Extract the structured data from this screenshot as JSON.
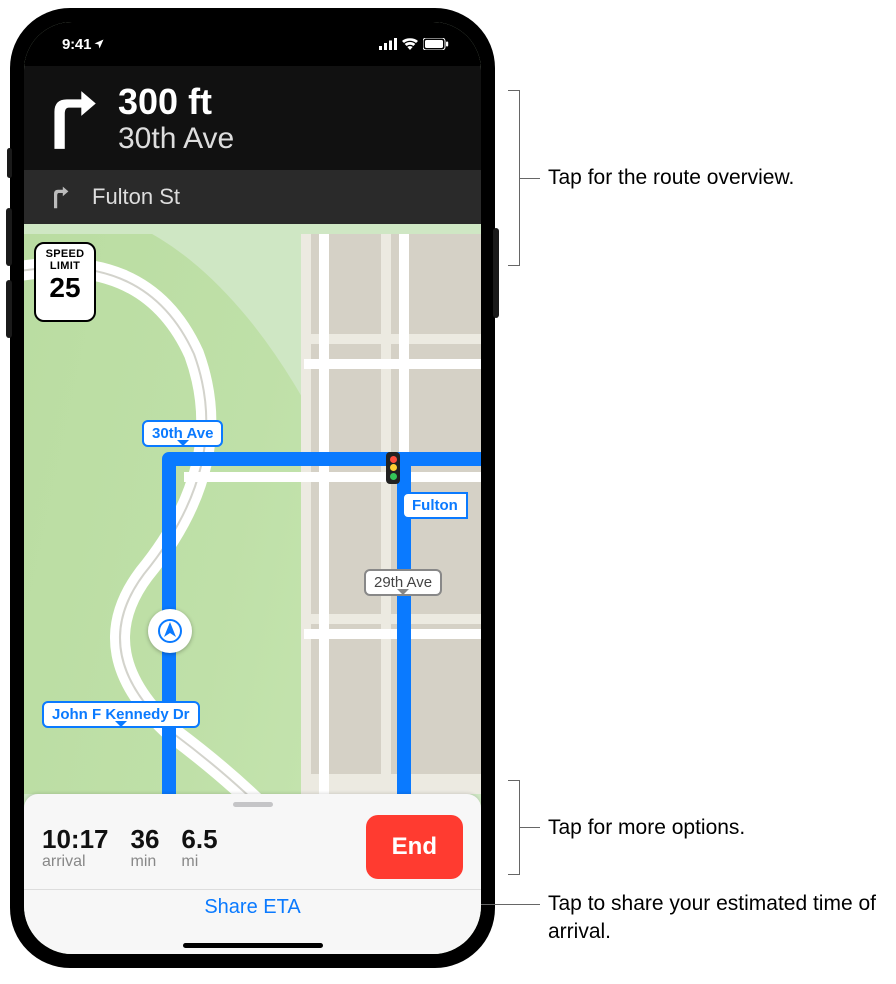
{
  "status_bar": {
    "time": "9:41"
  },
  "directions": {
    "primary": {
      "distance": "300 ft",
      "road": "30th Ave"
    },
    "secondary": {
      "road": "Fulton St"
    }
  },
  "speed_limit": {
    "label_top": "SPEED",
    "label_mid": "LIMIT",
    "value": "25"
  },
  "map_labels": {
    "route_a": "30th Ave",
    "route_b": "Fulton",
    "street_29": "29th Ave",
    "jfk": "John F Kennedy Dr"
  },
  "bottom": {
    "arrival_value": "10:17",
    "arrival_label": "arrival",
    "duration_value": "36",
    "duration_label": "min",
    "distance_value": "6.5",
    "distance_label": "mi",
    "end": "End",
    "share": "Share ETA"
  },
  "callouts": {
    "overview": "Tap for the route overview.",
    "options": "Tap for more options.",
    "share": "Tap to share your estimated time of arrival."
  }
}
